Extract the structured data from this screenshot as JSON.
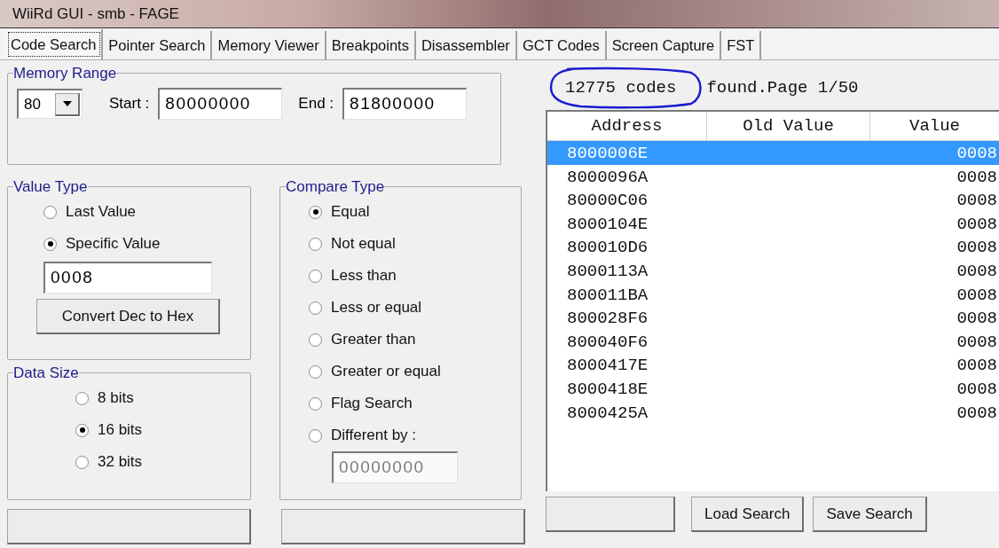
{
  "window": {
    "title": "WiiRd GUI - smb - FAGE"
  },
  "tabs": [
    {
      "label": "Code Search",
      "selected": true
    },
    {
      "label": "Pointer Search",
      "selected": false
    },
    {
      "label": "Memory Viewer",
      "selected": false
    },
    {
      "label": "Breakpoints",
      "selected": false
    },
    {
      "label": "Disassembler",
      "selected": false
    },
    {
      "label": "GCT Codes",
      "selected": false
    },
    {
      "label": "Screen Capture",
      "selected": false
    },
    {
      "label": "FST",
      "selected": false
    }
  ],
  "memory_range": {
    "title": "Memory Range",
    "segment": "80",
    "start_label": "Start :",
    "start": "80000000",
    "end_label": "End :",
    "end": "81800000"
  },
  "value_type": {
    "title": "Value Type",
    "options": [
      {
        "label": "Last Value",
        "selected": false
      },
      {
        "label": "Specific Value",
        "selected": true
      }
    ],
    "value": "0008",
    "convert_button": "Convert Dec to Hex"
  },
  "data_size": {
    "title": "Data Size",
    "options": [
      {
        "label": "8 bits",
        "selected": false
      },
      {
        "label": "16 bits",
        "selected": true
      },
      {
        "label": "32 bits",
        "selected": false
      }
    ]
  },
  "compare_type": {
    "title": "Compare Type",
    "options": [
      {
        "label": "Equal",
        "selected": true
      },
      {
        "label": "Not equal",
        "selected": false
      },
      {
        "label": "Less than",
        "selected": false
      },
      {
        "label": "Less or equal",
        "selected": false
      },
      {
        "label": "Greater than",
        "selected": false
      },
      {
        "label": "Greater or equal",
        "selected": false
      },
      {
        "label": "Flag Search",
        "selected": false
      },
      {
        "label": "Different by :",
        "selected": false
      }
    ],
    "different_by": {
      "value": "00000000",
      "disabled": true
    }
  },
  "results": {
    "summary": [
      "12775 codes",
      "found.Page 1/50"
    ],
    "columns": [
      "Address",
      "Old Value",
      "Value"
    ],
    "rows": [
      {
        "address": "8000006E",
        "value": "0008",
        "selected": true
      },
      {
        "address": "8000096A",
        "value": "0008",
        "selected": false
      },
      {
        "address": "80000C06",
        "value": "0008",
        "selected": false
      },
      {
        "address": "8000104E",
        "value": "0008",
        "selected": false
      },
      {
        "address": "800010D6",
        "value": "0008",
        "selected": false
      },
      {
        "address": "8000113A",
        "value": "0008",
        "selected": false
      },
      {
        "address": "800011BA",
        "value": "0008",
        "selected": false
      },
      {
        "address": "800028F6",
        "value": "0008",
        "selected": false
      },
      {
        "address": "800040F6",
        "value": "0008",
        "selected": false
      },
      {
        "address": "8000417E",
        "value": "0008",
        "selected": false
      },
      {
        "address": "8000418E",
        "value": "0008",
        "selected": false
      },
      {
        "address": "8000425A",
        "value": "0008",
        "selected": false
      }
    ]
  },
  "bottom_buttons": [
    "Load Search",
    "Save Search"
  ]
}
